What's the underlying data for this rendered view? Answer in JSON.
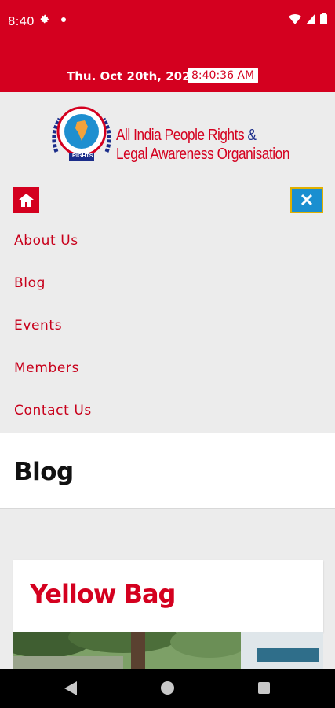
{
  "status": {
    "time": "8:40",
    "icons": [
      "gear-icon",
      "dot-icon",
      "wifi-icon",
      "signal-icon",
      "battery-icon"
    ]
  },
  "datebar": {
    "date": "Thu. Oct 20th, 2022",
    "clock": "8:40:36 AM"
  },
  "logo": {
    "line1": "All India People Rights",
    "amp": "&",
    "line2": "Legal Awareness Organisation",
    "emblem_text": "RIGHTS"
  },
  "menu": {
    "home_icon": "home-icon",
    "close_label": "✕",
    "items": [
      "About Us",
      "Blog",
      "Events",
      "Members",
      "Contact Us"
    ]
  },
  "page": {
    "title": "Blog"
  },
  "post": {
    "title": "Yellow Bag"
  },
  "colors": {
    "brand_red": "#d4001f",
    "close_blue": "#1a8fd0",
    "background": "#ececec"
  }
}
